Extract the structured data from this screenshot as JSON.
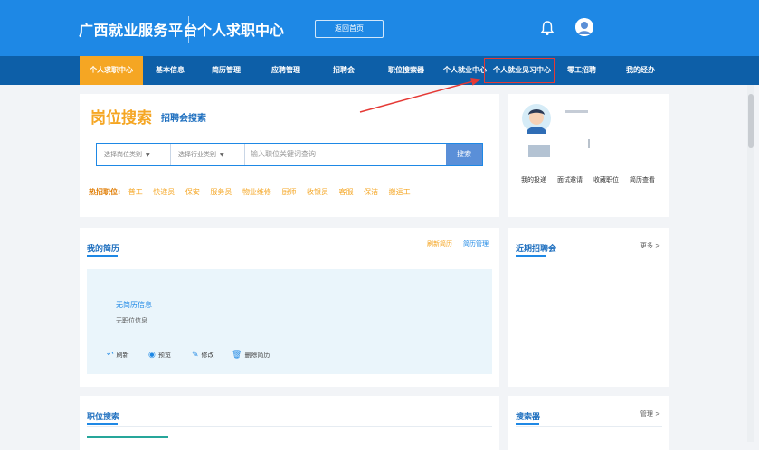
{
  "header": {
    "logo": "广西就业服务平台",
    "subtitle": "个人求职中心",
    "home_button": "返回首页"
  },
  "nav": {
    "items": [
      {
        "label": "个人求职中心",
        "active": true
      },
      {
        "label": "基本信息"
      },
      {
        "label": "简历管理"
      },
      {
        "label": "应聘管理"
      },
      {
        "label": "招聘会"
      },
      {
        "label": "职位搜索器"
      },
      {
        "label": "个人就业中心"
      },
      {
        "label": "个人就业见习中心",
        "highlighted": true
      },
      {
        "label": "零工招聘"
      },
      {
        "label": "我的经办"
      }
    ]
  },
  "search": {
    "title": "岗位搜索",
    "tab": "招聘会搜索",
    "select_position": "选择岗位类别",
    "select_industry": "选择行业类别",
    "keyword_placeholder": "输入职位关键词查询",
    "button": "搜索",
    "hot_label": "热招职位:",
    "hot_items": [
      "普工",
      "快递员",
      "保安",
      "服务员",
      "物业维修",
      "厨师",
      "收银员",
      "客服",
      "保洁",
      "搬运工"
    ]
  },
  "profile": {
    "links": [
      "我的投递",
      "面试邀请",
      "收藏职位",
      "简历查看"
    ]
  },
  "resume": {
    "title": "我的简历",
    "refresh": "刷新简历",
    "manage": "简历管理",
    "no_resume": "无简历信息",
    "no_job": "无职位信息",
    "actions": [
      "刷新",
      "预览",
      "修改",
      "删除简历"
    ]
  },
  "recruit": {
    "title": "近期招聘会",
    "more": "更多 >"
  },
  "jobsearch": {
    "title": "职位搜索"
  },
  "searcher": {
    "title": "搜索器",
    "manage": "管理 >"
  },
  "colors": {
    "header": "#1e88e5",
    "nav": "#0d5fa8",
    "active": "#f5a623",
    "highlight": "#e53935"
  }
}
